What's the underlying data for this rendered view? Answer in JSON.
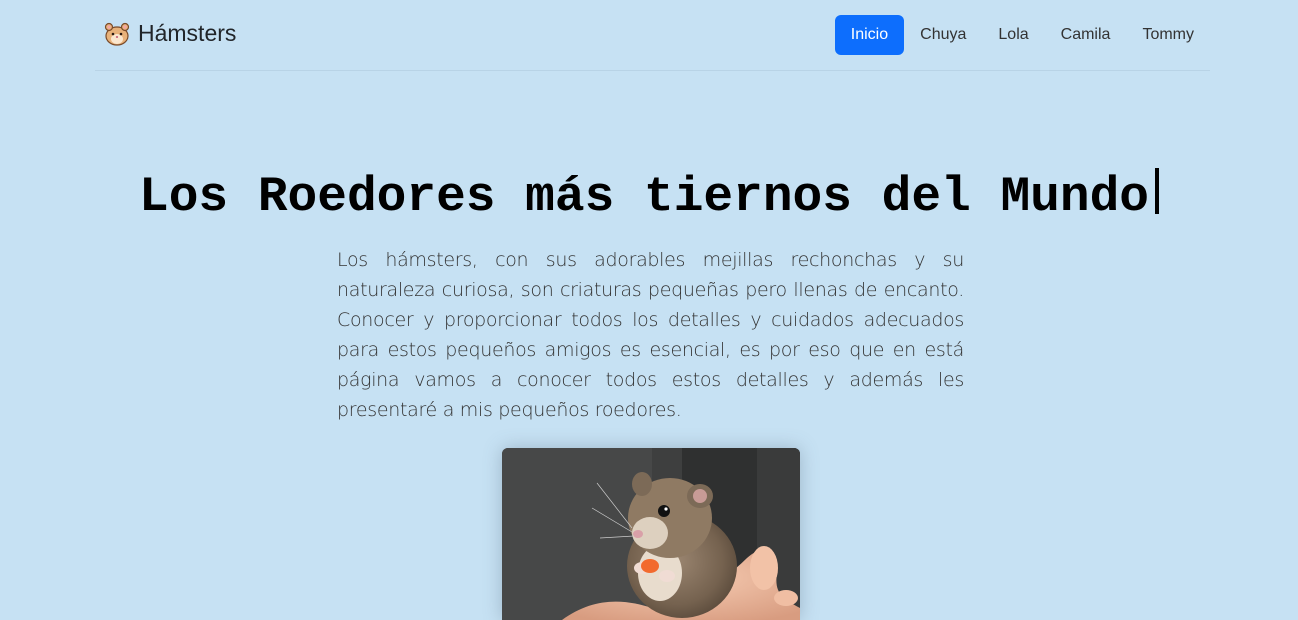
{
  "header": {
    "brand_text": "Hámsters",
    "brand_icon": "hamster-icon",
    "nav": [
      {
        "label": "Inicio",
        "active": true
      },
      {
        "label": "Chuya",
        "active": false
      },
      {
        "label": "Lola",
        "active": false
      },
      {
        "label": "Camila",
        "active": false
      },
      {
        "label": "Tommy",
        "active": false
      }
    ]
  },
  "hero": {
    "title": "Los Roedores más tiernos del Mundo",
    "description": "Los hámsters, con sus adorables mejillas rechonchas y su naturaleza curiosa, son criaturas pequeñas pero llenas de encanto. Conocer y proporcionar todos los detalles y cuidados adecuados para estos pequeños amigos es esencial, es por eso que en está página vamos a conocer todos estos detalles y además les presentaré a mis pequeños roedores."
  },
  "colors": {
    "background": "#c6e1f3",
    "accent": "#0d6efd"
  }
}
